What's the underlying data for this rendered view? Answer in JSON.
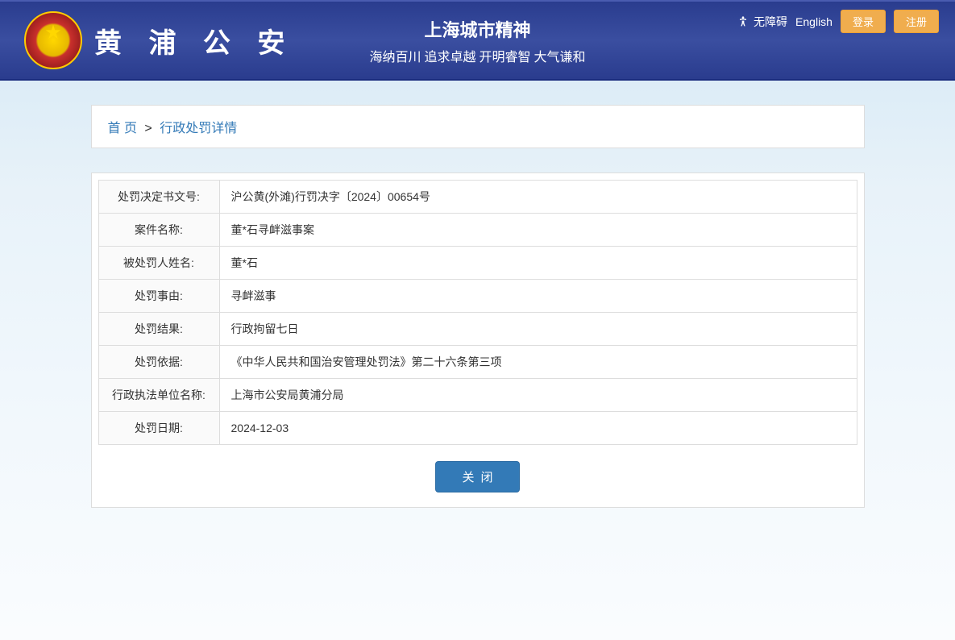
{
  "header": {
    "site_title": "黄 浦 公 安",
    "slogan_main": "上海城市精神",
    "slogan_sub": "海纳百川 追求卓越 开明睿智 大气谦和",
    "accessibility": "无障碍",
    "english": "English",
    "login": "登录",
    "register": "注册"
  },
  "breadcrumb": {
    "home": "首 页",
    "sep": ">",
    "current": "行政处罚详情"
  },
  "details": [
    {
      "label": "处罚决定书文号:",
      "value": "沪公黄(外滩)行罚决字〔2024〕00654号"
    },
    {
      "label": "案件名称:",
      "value": "董*石寻衅滋事案"
    },
    {
      "label": "被处罚人姓名:",
      "value": "董*石"
    },
    {
      "label": "处罚事由:",
      "value": "寻衅滋事"
    },
    {
      "label": "处罚结果:",
      "value": "行政拘留七日"
    },
    {
      "label": "处罚依据:",
      "value": "《中华人民共和国治安管理处罚法》第二十六条第三项"
    },
    {
      "label": "行政执法单位名称:",
      "value": "上海市公安局黄浦分局"
    },
    {
      "label": "处罚日期:",
      "value": "2024-12-03"
    }
  ],
  "buttons": {
    "close": "关闭"
  }
}
